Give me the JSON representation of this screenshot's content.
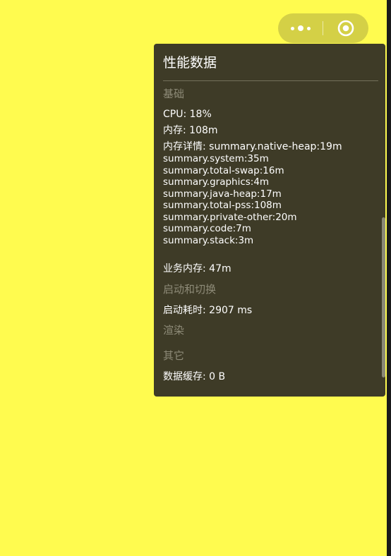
{
  "capsule": {
    "more_icon": "more-dots-icon",
    "close_icon": "target-circle-icon"
  },
  "panel": {
    "title": "性能数据",
    "sections": {
      "basic": "基础",
      "launch": "启动和切换",
      "render": "渲染",
      "other": "其它"
    },
    "cpu": "CPU: 18%",
    "memory": "内存: 108m",
    "memory_detail_label": "内存详情: summary.native-heap:19m",
    "memory_detail_lines": [
      "summary.system:35m",
      "summary.total-swap:16m",
      "summary.graphics:4m",
      "summary.java-heap:17m",
      "summary.total-pss:108m",
      "summary.private-other:20m",
      "summary.code:7m",
      "summary.stack:3m"
    ],
    "business_memory": "业务内存: 47m",
    "launch_time": "启动耗时: 2907 ms",
    "data_cache": "数据缓存: 0 B"
  },
  "colors": {
    "background": "#fffb4f",
    "capsule": "#d4d046",
    "panel": "#3e3b27",
    "section_text": "#8e8b78"
  }
}
